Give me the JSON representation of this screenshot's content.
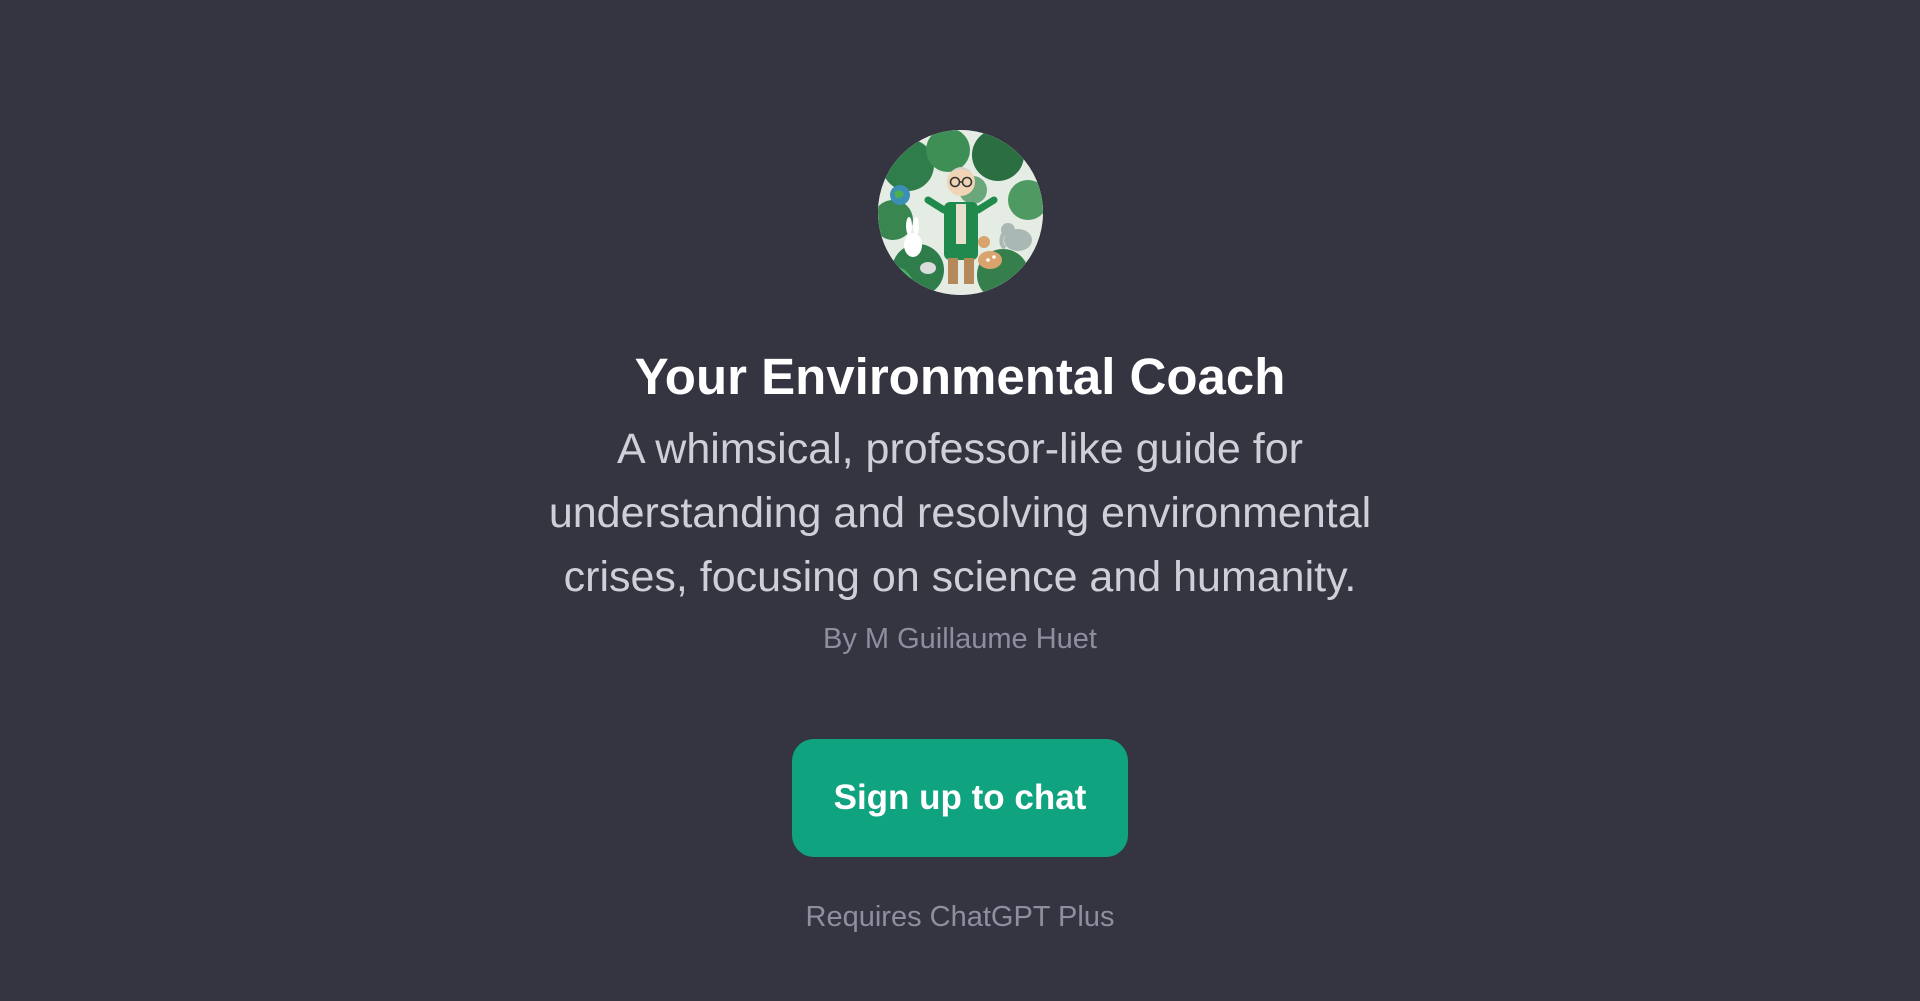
{
  "gpt": {
    "avatar_icon": "environmental-professor-illustration",
    "title": "Your Environmental Coach",
    "description": "A whimsical, professor-like guide for understanding and resolving environmental crises, focusing on science and humanity.",
    "author": "By M Guillaume Huet"
  },
  "cta": {
    "signup_label": "Sign up to chat",
    "requirement_note": "Requires ChatGPT Plus"
  },
  "colors": {
    "background": "#343541",
    "accent": "#10a37f",
    "title": "#ffffff",
    "description": "#cfcfd8",
    "muted": "#8e8ea0"
  }
}
